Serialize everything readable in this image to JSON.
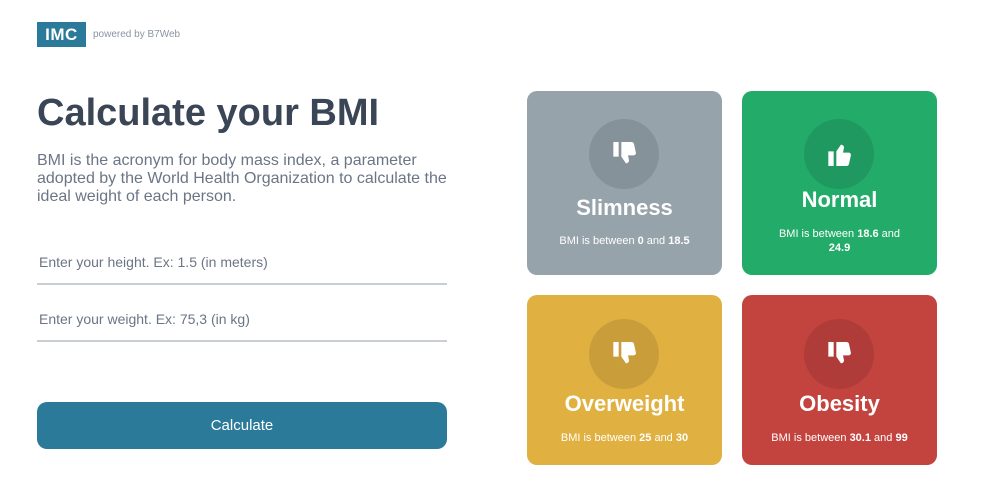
{
  "header": {
    "logo": "IMC",
    "powered_by": "powered by B7Web"
  },
  "main": {
    "title": "Calculate your BMI",
    "description": "BMI is the acronym for body mass index, a parameter adopted by the World Health Organization to calculate the ideal weight of each person.",
    "height_placeholder": "Enter your height. Ex: 1.5 (in meters)",
    "weight_placeholder": "Enter your weight. Ex: 75,3 (in kg)",
    "height_value": "",
    "weight_value": "",
    "calculate_label": "Calculate"
  },
  "cards": [
    {
      "title": "Slimness",
      "prefix": "BMI is between ",
      "min": "0",
      "and": " and ",
      "max": "18.5",
      "color": "#96a3ab",
      "icon": "thumbs-down-icon"
    },
    {
      "title": "Normal",
      "prefix": "BMI is between ",
      "min": "18.6",
      "and": " and ",
      "max": "24.9",
      "color": "#23ab6a",
      "icon": "thumbs-up-icon"
    },
    {
      "title": "Overweight",
      "prefix": "BMI is between ",
      "min": "25",
      "and": " and ",
      "max": "30",
      "color": "#e0b041",
      "icon": "thumbs-down-icon"
    },
    {
      "title": "Obesity",
      "prefix": "BMI is between ",
      "min": "30.1",
      "and": " and ",
      "max": "99",
      "color": "#c3433f",
      "icon": "thumbs-down-icon"
    }
  ]
}
